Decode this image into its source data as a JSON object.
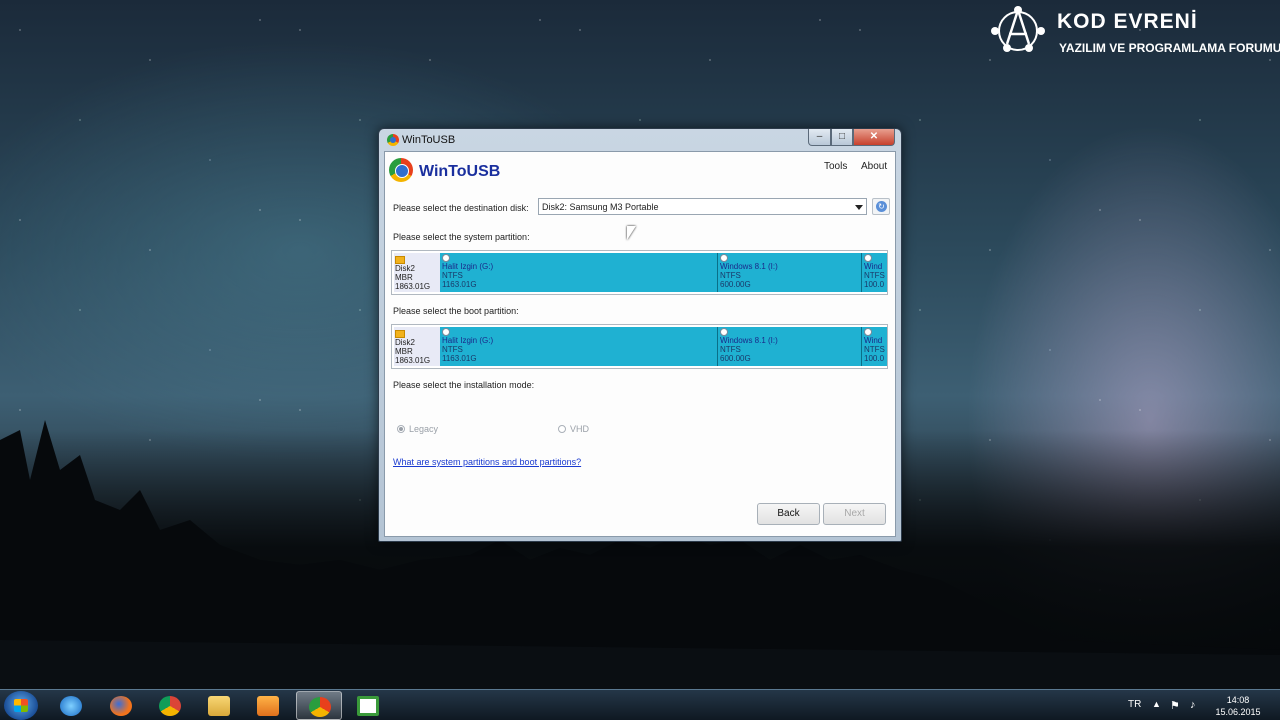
{
  "watermark": {
    "title": "KOD EVRENİ",
    "subtitle": "YAZILIM VE PROGRAMLAMA FORUMU"
  },
  "window": {
    "title": "WinToUSB",
    "app_name": "WinToUSB",
    "menu": {
      "tools": "Tools",
      "about": "About"
    },
    "controls": {
      "minimize": "–",
      "maximize": "□",
      "close": "✕"
    },
    "destination_label": "Please select the destination disk:",
    "destination_value": "Disk2: Samsung M3 Portable",
    "system_partition_label": "Please select the system partition:",
    "boot_partition_label": "Please select the boot partition:",
    "disk": {
      "name": "Disk2",
      "type": "MBR",
      "size": "1863.01G"
    },
    "partitions": [
      {
        "name": "Halit Izgin (G:)",
        "fs": "NTFS",
        "size": "1163.01G"
      },
      {
        "name": "Windows 8.1 (I:)",
        "fs": "NTFS",
        "size": "600.00G"
      },
      {
        "name": "Wind",
        "fs": "NTFS",
        "size": "100.0"
      }
    ],
    "boot_partitions": [
      {
        "name": "Halit Izgin (G:)",
        "fs": "NTFS",
        "size": "1163.01G"
      },
      {
        "name": "Windows 8.1 (I:)",
        "fs": "NTFS",
        "size": "600.00G"
      },
      {
        "name": "Wind",
        "fs": "NTFS",
        "size": "100.0"
      }
    ],
    "mode_label": "Please select the installation mode:",
    "modes": [
      {
        "label": "Legacy",
        "selected": true,
        "enabled": false
      },
      {
        "label": "VHD",
        "selected": false,
        "enabled": false
      }
    ],
    "help_link": "What are system partitions and boot partitions?",
    "buttons": {
      "back": "Back",
      "next": "Next"
    },
    "colors": {
      "partition_fill": "#1fb1d2",
      "title_color": "#1a2f9e",
      "link_color": "#1a3ad0"
    }
  },
  "taskbar": {
    "items": [
      {
        "name": "internet-explorer",
        "icon": "ie-icon"
      },
      {
        "name": "firefox",
        "icon": "firefox-icon"
      },
      {
        "name": "chrome",
        "icon": "chrome-icon"
      },
      {
        "name": "file-explorer",
        "icon": "folder-icon"
      },
      {
        "name": "media-player",
        "icon": "media-player-icon"
      },
      {
        "name": "wintousb",
        "icon": "wintousb-icon",
        "active": true
      },
      {
        "name": "camtasia",
        "icon": "camtasia-icon"
      }
    ],
    "language": "TR",
    "time": "14:08",
    "date": "15.06.2015"
  }
}
